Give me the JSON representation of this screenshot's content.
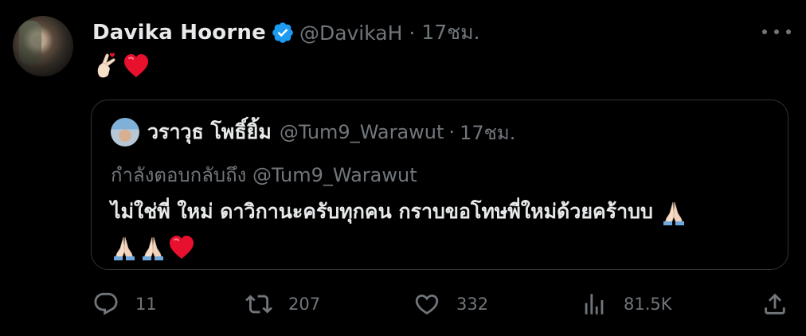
{
  "tweet": {
    "author_name": "Davika Hoorne",
    "handle": "@DavikaH",
    "separator": "·",
    "time": "17ชม.",
    "content_emojis": [
      "finger-heart-emoji",
      "red-heart-emoji"
    ]
  },
  "quoted": {
    "author_name": "วราวุธ โพธิ์ยิ้ม",
    "handle": "@Tum9_Warawut",
    "separator": "·",
    "time": "17ชม.",
    "reply_context": "กำลังตอบกลับถึง @Tum9_Warawut",
    "text": "ไม่ใช่พี่ ใหม่ ดาวิกานะครับทุกคน กราบขอโทษพี่ใหม่ด้วยคร้าบบ"
  },
  "actions": {
    "replies": "11",
    "retweets": "207",
    "likes": "332",
    "views": "81.5K"
  },
  "colors": {
    "background": "#000000",
    "text": "#e7e9ea",
    "muted": "#71767b",
    "border": "#2f3336",
    "verified": "#1d9bf0",
    "heart": "#e8112d"
  }
}
